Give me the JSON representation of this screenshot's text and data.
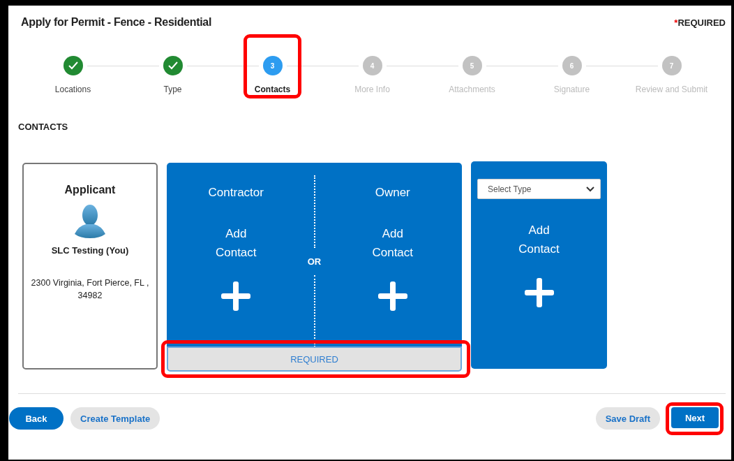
{
  "window": {
    "title": "Apply for Permit - Fence - Residential",
    "required_note": {
      "mark": "*",
      "text": "REQUIRED"
    }
  },
  "steps": [
    {
      "label": "Locations",
      "completed": true,
      "current": false,
      "highlighted": false
    },
    {
      "label": "Type",
      "completed": true,
      "current": false,
      "highlighted": false
    },
    {
      "number": "3",
      "label": "Contacts",
      "completed": false,
      "current": true,
      "highlighted": true
    },
    {
      "number": "4",
      "label": "More Info",
      "completed": false,
      "current": false,
      "highlighted": false
    },
    {
      "number": "5",
      "label": "Attachments",
      "completed": false,
      "current": false,
      "highlighted": false
    },
    {
      "number": "6",
      "label": "Signature",
      "completed": false,
      "current": false,
      "highlighted": false
    },
    {
      "number": "7",
      "label": "Review and Submit",
      "completed": false,
      "current": false,
      "highlighted": false
    }
  ],
  "section_title": "CONTACTS",
  "applicant": {
    "heading": "Applicant",
    "name": "SLC Testing (You)",
    "address": "2300 Virginia, Fort Pierce, FL , 34982"
  },
  "choice_card": {
    "options": [
      {
        "heading": "Contractor",
        "action": "Add Contact"
      },
      {
        "heading": "Owner",
        "action": "Add Contact"
      }
    ],
    "separator": "OR",
    "required_bar": {
      "text": "REQUIRED",
      "highlighted": true
    }
  },
  "extra_card": {
    "select_placeholder": "Select Type",
    "action": "Add Contact"
  },
  "left_buttons": [
    {
      "label": "Back",
      "kind": "primary",
      "highlighted": false
    },
    {
      "label": "Create Template",
      "kind": "secondary",
      "highlighted": false
    }
  ],
  "right_buttons": [
    {
      "label": "Save Draft",
      "kind": "secondary",
      "highlighted": false
    },
    {
      "label": "Next",
      "kind": "square",
      "highlighted": true
    }
  ]
}
